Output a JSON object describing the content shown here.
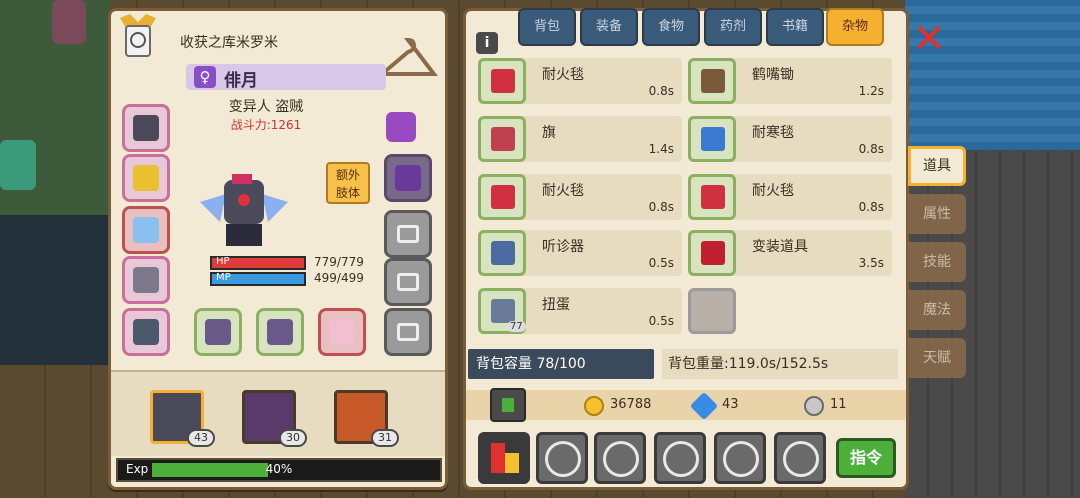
{
  "character": {
    "house": "收获之库米罗米",
    "name": "俳月",
    "class": "变异人 盗贼",
    "power": "战斗力:1261",
    "hp_label": "HP",
    "hp": "779/779",
    "mp_label": "MP",
    "mp": "499/499",
    "extra_limb": "额外\n肢体"
  },
  "party": [
    {
      "level": "43",
      "color": "#4a4a5a"
    },
    {
      "level": "30",
      "color": "#5a3a6a"
    },
    {
      "level": "31",
      "color": "#c85a2a"
    }
  ],
  "exp": {
    "label": "Exp",
    "percent": "40%",
    "fraction": 0.4
  },
  "tabs": [
    "背包",
    "装备",
    "食物",
    "药剂",
    "书籍",
    "杂物"
  ],
  "active_tab": "杂物",
  "items": [
    {
      "name": "耐火毯",
      "time": "0.8s",
      "color": "#d03040"
    },
    {
      "name": "鹤嘴锄",
      "time": "1.2s",
      "color": "#7a5a3a"
    },
    {
      "name": "旗",
      "time": "1.4s",
      "color": "#c04050"
    },
    {
      "name": "耐寒毯",
      "time": "0.8s",
      "color": "#3a7ad0"
    },
    {
      "name": "耐火毯",
      "time": "0.8s",
      "color": "#d03040"
    },
    {
      "name": "耐火毯",
      "time": "0.8s",
      "color": "#d03040"
    },
    {
      "name": "听诊器",
      "time": "0.5s",
      "color": "#4a6aa0"
    },
    {
      "name": "变装道具",
      "time": "3.5s",
      "color": "#c02030"
    },
    {
      "name": "扭蛋",
      "time": "0.5s",
      "color": "#6a7a9a",
      "count": "77"
    }
  ],
  "capacity": "背包容量 78/100",
  "weight": "背包重量:119.0s/152.5s",
  "currency": {
    "gold": "36788",
    "gem": "43",
    "silver": "11"
  },
  "command": "指令",
  "side_tabs": [
    "道具",
    "属性",
    "技能",
    "魔法",
    "天赋"
  ],
  "active_side": "道具",
  "colors": {
    "accent": "#f6b030",
    "panel": "#f2ead4",
    "border": "#7a5c38",
    "hp": "#e03a3a",
    "mp": "#3a9ae0"
  }
}
